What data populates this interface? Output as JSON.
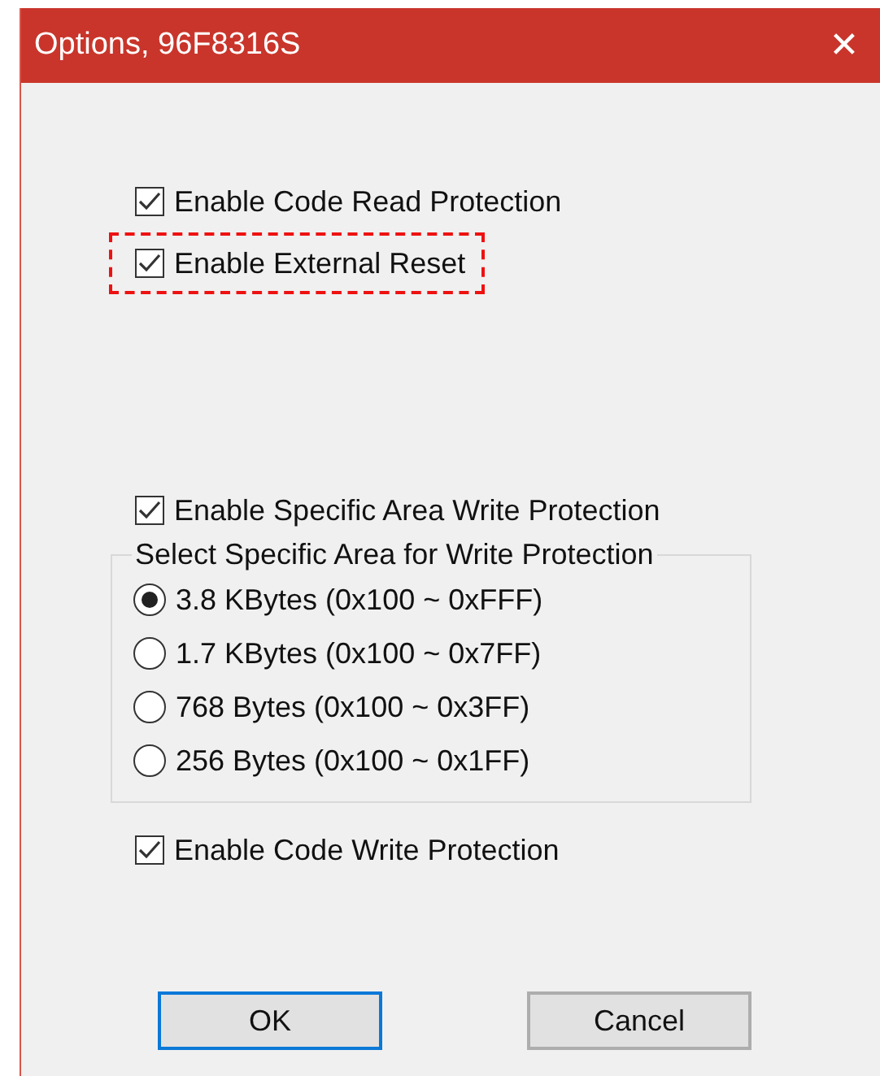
{
  "window": {
    "title": "Options, 96F8316S",
    "close": "✕"
  },
  "top_checkboxes": [
    {
      "label": "Enable Code Read Protection",
      "checked": true,
      "highlighted": false
    },
    {
      "label": "Enable External Reset",
      "checked": true,
      "highlighted": true
    }
  ],
  "area_checkbox": {
    "label": "Enable Specific Area Write Protection",
    "checked": true
  },
  "area_group": {
    "title": "Select Specific Area for Write Protection",
    "options": [
      {
        "label": "3.8 KBytes (0x100 ~ 0xFFF)",
        "selected": true
      },
      {
        "label": "1.7 KBytes (0x100 ~ 0x7FF)",
        "selected": false
      },
      {
        "label": "768 Bytes (0x100 ~ 0x3FF)",
        "selected": false
      },
      {
        "label": "256 Bytes (0x100 ~ 0x1FF)",
        "selected": false
      }
    ]
  },
  "code_write_checkbox": {
    "label": "Enable Code Write Protection",
    "checked": true
  },
  "buttons": [
    {
      "label": "OK",
      "default": true
    },
    {
      "label": "Cancel",
      "default": false
    }
  ]
}
